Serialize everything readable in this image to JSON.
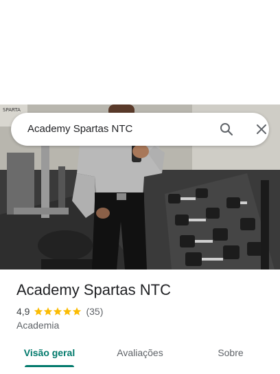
{
  "search": {
    "query": "Academy Spartas NTC",
    "search_icon": "search-icon",
    "close_icon": "close-icon"
  },
  "photo": {
    "gym_sign": "SPARTA"
  },
  "place": {
    "title": "Academy Spartas NTC",
    "rating": "4,9",
    "stars": 5,
    "review_count": "(35)",
    "category": "Academia"
  },
  "tabs": [
    {
      "label": "Visão geral",
      "active": true
    },
    {
      "label": "Avaliações",
      "active": false
    },
    {
      "label": "Sobre",
      "active": false
    }
  ],
  "colors": {
    "accent": "#00796b",
    "star": "#fbbc04"
  }
}
